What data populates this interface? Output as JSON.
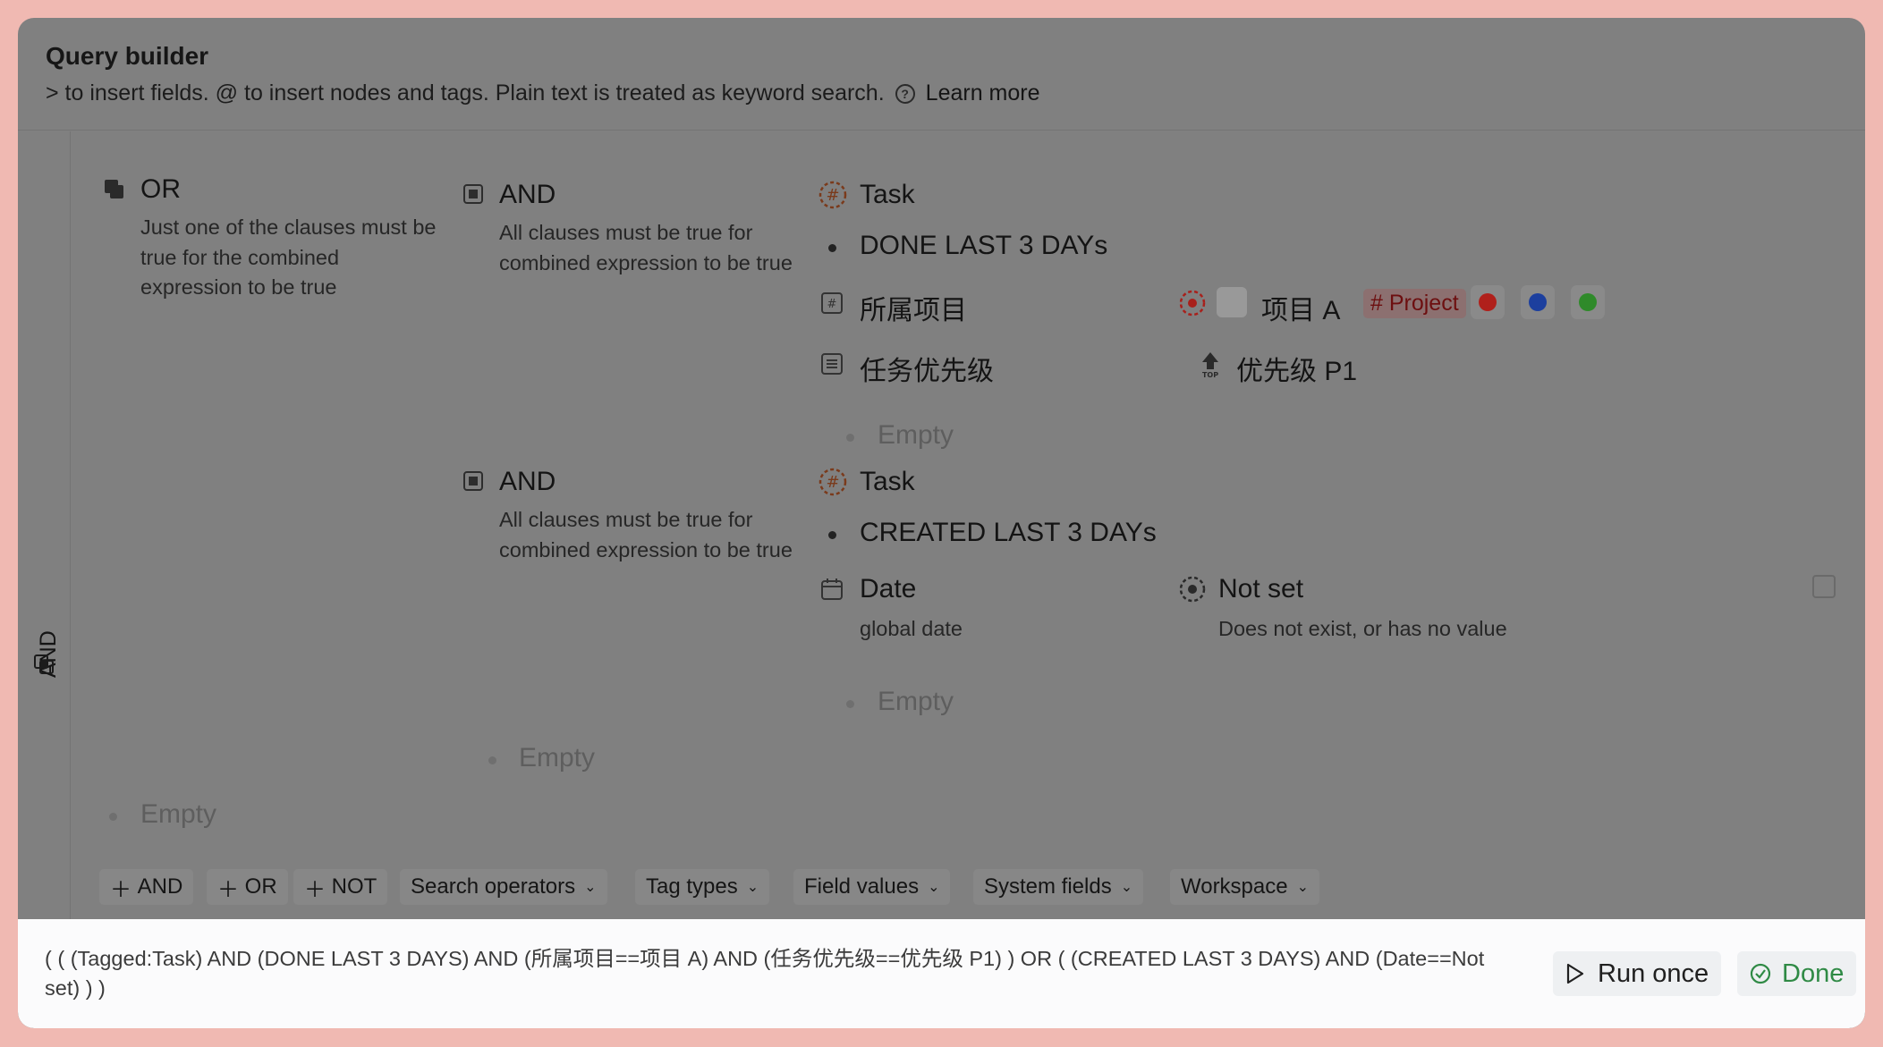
{
  "header": {
    "title": "Query builder",
    "subtitle": "> to insert fields. @ to insert nodes and tags. Plain text is treated as keyword search.",
    "learn_more": "Learn more"
  },
  "sidebar": {
    "label": "AND"
  },
  "or_block": {
    "label": "OR",
    "description": "Just one of the clauses must be true for the combined expression to be true",
    "empty": "Empty"
  },
  "and_block_1": {
    "label": "AND",
    "description": "All clauses must be true for combined expression to be true",
    "tag": "Task",
    "filter": "DONE LAST 3 DAYs",
    "field1_name": "所属项目",
    "field1_value": "项目 A",
    "field1_tag": "# Project",
    "field2_name": "任务优先级",
    "field2_value": "优先级 P1",
    "empty": "Empty"
  },
  "and_block_2": {
    "label": "AND",
    "description": "All clauses must be true for combined expression to be true",
    "tag": "Task",
    "filter": "CREATED LAST 3 DAYs",
    "field_name": "Date",
    "field_sub": "global date",
    "value": "Not set",
    "value_desc": "Does not exist, or has no value",
    "empty": "Empty"
  },
  "or_empty": "Empty",
  "toolbar": {
    "add_and": "AND",
    "add_or": "OR",
    "add_not": "NOT",
    "search_operators": "Search operators",
    "tag_types": "Tag types",
    "field_values": "Field values",
    "system_fields": "System fields",
    "workspace": "Workspace"
  },
  "footer": {
    "expression": "( ( (Tagged:Task) AND (DONE LAST 3 DAYS) AND (所属项目==项目 A) AND (任务优先级==优先级 P1) ) OR ( (CREATED LAST 3 DAYS) AND (Date==Not set) ) )",
    "run_once": "Run once",
    "done": "Done"
  },
  "colors": {
    "red": "#b0201b",
    "blue": "#1c3f9e",
    "green": "#2f8a2a",
    "done_green": "#2f8a45",
    "tag_text": "#6d0f10"
  }
}
